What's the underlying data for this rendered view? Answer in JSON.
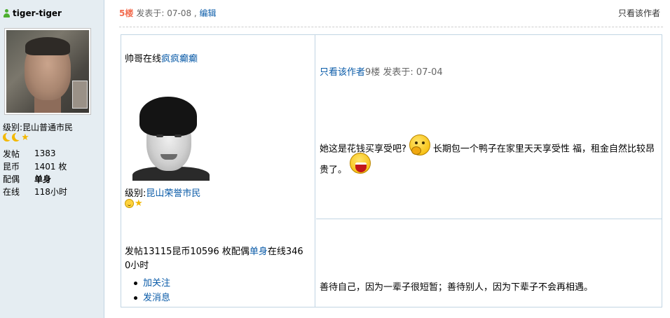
{
  "user": {
    "name": "tiger-tiger",
    "level_label": "级别:",
    "level_value": "昆山普通市民",
    "stats": [
      {
        "key": "发帖",
        "value": "1383",
        "bold": false
      },
      {
        "key": "昆币",
        "value": "1401 枚",
        "bold": false
      },
      {
        "key": "配偶",
        "value": "单身",
        "bold": true
      },
      {
        "key": "在线",
        "value": "118小时",
        "bold": false
      }
    ]
  },
  "post": {
    "floor": "5楼",
    "time_prefix": "发表于: 07-08 ,",
    "edit_link": "编辑",
    "only_author": "只看该作者"
  },
  "quote": {
    "left": {
      "line1_text": "帅哥在线",
      "line1_link": "疯疯癫癫",
      "level_label": "级别:",
      "level_link": "昆山荣誉市民",
      "stats_line1_a": "发帖13115昆币10596 枚配偶",
      "stats_line1_link": "单身",
      "stats_line1_b": "在线346",
      "stats_line2": "0小时",
      "links": [
        "加关注",
        "发消息"
      ]
    },
    "right": {
      "only_author": "只看该作者",
      "meta": "9楼 发表于: 07-04",
      "text_part1": "她这是花钱买享受吧?",
      "text_part2": "长期包一个鸭子在家里天天享受性 福，租金自然比较昂贵了。",
      "bottom_text": "善待自己，因为一辈子很短暂；善待别人，因为下辈子不会再相遇。"
    }
  },
  "colors": {
    "sidebar_bg": "#e5edf2",
    "border": "#c2d5e3",
    "link": "#0a5ba8",
    "floor": "#f26c4f"
  }
}
